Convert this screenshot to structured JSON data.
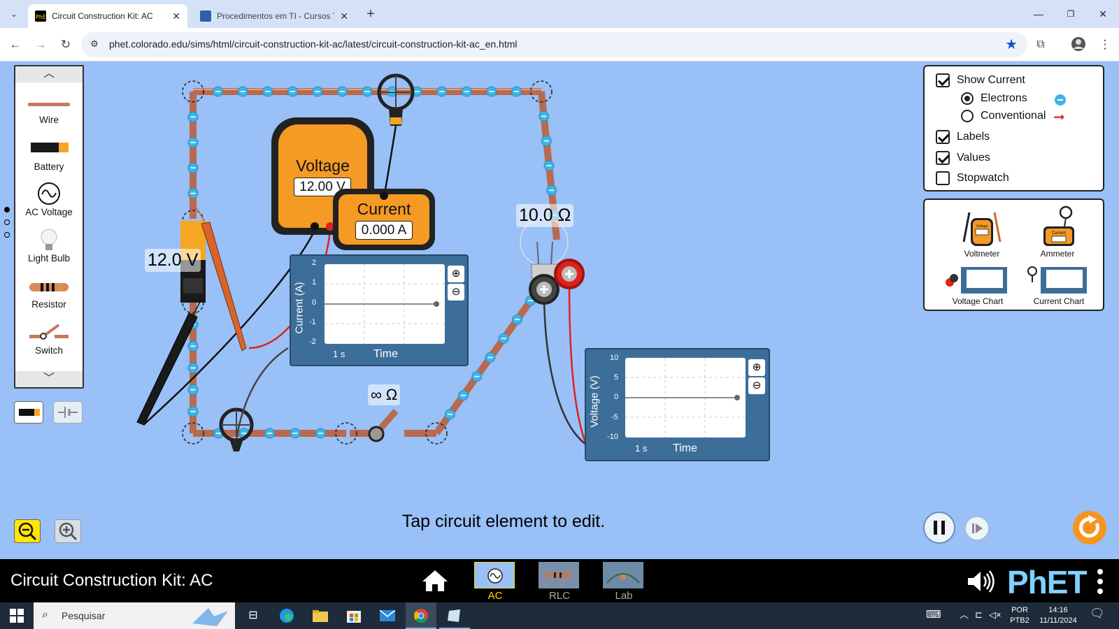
{
  "browser": {
    "tabs": [
      {
        "title": "Circuit Construction Kit: AC",
        "active": true
      },
      {
        "title": "Procedimentos em TI - Cursos T",
        "active": false
      }
    ],
    "new_tab": "+",
    "url": "phet.colorado.edu/sims/html/circuit-construction-kit-ac/latest/circuit-construction-kit-ac_en.html"
  },
  "toolbox": {
    "items": [
      {
        "label": "Wire",
        "icon": "wire-icon"
      },
      {
        "label": "Battery",
        "icon": "battery-icon"
      },
      {
        "label": "AC Voltage",
        "icon": "ac-voltage-icon"
      },
      {
        "label": "Light Bulb",
        "icon": "light-bulb-icon"
      },
      {
        "label": "Resistor",
        "icon": "resistor-icon"
      },
      {
        "label": "Switch",
        "icon": "switch-icon"
      }
    ]
  },
  "circuit": {
    "battery_value": "12.0 V",
    "resistor_value": "10.0 Ω",
    "switch_value": "∞ Ω"
  },
  "voltmeter": {
    "title": "Voltage",
    "value": "12.00 V"
  },
  "ammeter": {
    "title": "Current",
    "value": "0.000 A"
  },
  "current_chart": {
    "ylabel": "Current (A)",
    "xlabel": "Time",
    "yticks": [
      "2",
      "1",
      "0",
      "-1",
      "-2"
    ],
    "scale": "1 s"
  },
  "voltage_chart": {
    "ylabel": "Voltage (V)",
    "xlabel": "Time",
    "yticks": [
      "10",
      "5",
      "0",
      "-5",
      "-10"
    ],
    "scale": "1 s"
  },
  "controls": {
    "show_current": {
      "label": "Show Current",
      "checked": true
    },
    "electrons": {
      "label": "Electrons",
      "selected": true
    },
    "conventional": {
      "label": "Conventional",
      "selected": false
    },
    "labels": {
      "label": "Labels",
      "checked": true
    },
    "values": {
      "label": "Values",
      "checked": true
    },
    "stopwatch": {
      "label": "Stopwatch",
      "checked": false
    }
  },
  "sensors": {
    "voltmeter": "Voltmeter",
    "ammeter": "Ammeter",
    "voltage_chart": "Voltage Chart",
    "current_chart": "Current Chart",
    "voltmeter_icon_text": "Voltage",
    "ammeter_icon_text": "Current"
  },
  "status_message": "Tap circuit element to edit.",
  "navbar": {
    "sim_title": "Circuit Construction Kit: AC",
    "screens": [
      {
        "label": "AC Voltage",
        "active": true
      },
      {
        "label": "RLC",
        "active": false
      },
      {
        "label": "Lab",
        "active": false
      }
    ],
    "logo": "PhET"
  },
  "taskbar": {
    "search_placeholder": "Pesquisar",
    "lang": "POR",
    "layout": "PTB2",
    "time": "14:16",
    "date": "11/11/2024"
  },
  "colors": {
    "sim_background": "#99c0f7",
    "meter_orange": "#f59a24",
    "chart_blue": "#3d6e9a",
    "electron": "#3fb4e8",
    "active_screen": "#ffdc00"
  }
}
